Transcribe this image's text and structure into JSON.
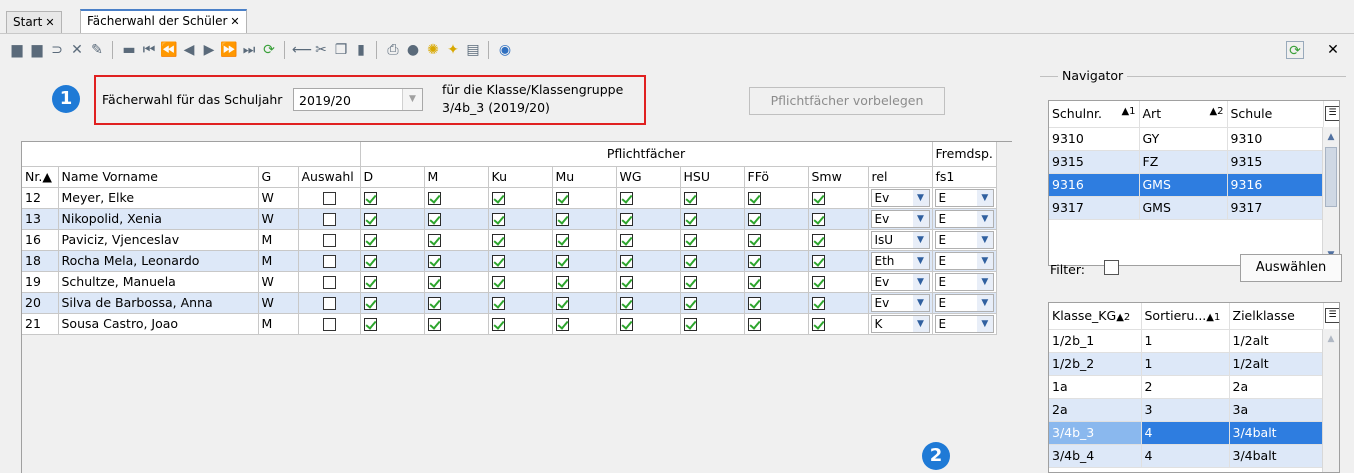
{
  "tabs": [
    {
      "label": "Start",
      "close": "✕"
    },
    {
      "label": "Fächerwahl der Schüler",
      "close": "✕"
    }
  ],
  "toolbar": {
    "icons": [
      "save-icon",
      "save-all-icon",
      "undo-icon",
      "delete-icon",
      "edit-icon",
      "new-icon",
      "first-icon",
      "prev-page-icon",
      "prev-icon",
      "next-icon",
      "next-page-icon",
      "last-icon",
      "refresh-icon",
      "back-icon",
      "cut-icon",
      "copy-icon",
      "paste-icon",
      "print-icon",
      "preview-icon",
      "hint-icon",
      "clean-icon",
      "list-icon",
      "help-icon"
    ],
    "right_icons": [
      "sync-icon",
      "close-icon"
    ],
    "close_label": "✕"
  },
  "header": {
    "badge1": "1",
    "schuljahr_label": "Fächerwahl für das Schuljahr",
    "schuljahr_value": "2019/20",
    "klasse_label": "für die Klasse/Klassengruppe",
    "klasse_value": "3/4b_3 (2019/20)",
    "pflicht_button": "Pflichtfächer vorbelegen"
  },
  "grid": {
    "group_pflicht": "Pflichtfächer",
    "group_fremd": "Fremdsp.",
    "columns": [
      "Nr.",
      "Name Vorname",
      "G",
      "Auswahl",
      "D",
      "M",
      "Ku",
      "Mu",
      "WG",
      "HSU",
      "FFö",
      "Smw",
      "rel",
      "fs1"
    ],
    "sort_indicator": "▲",
    "rows": [
      {
        "nr": "12",
        "name": "Meyer, Elke",
        "g": "W",
        "rel": "Ev",
        "fs1": "E"
      },
      {
        "nr": "13",
        "name": "Nikopolid, Xenia",
        "g": "W",
        "rel": "Ev",
        "fs1": "E"
      },
      {
        "nr": "16",
        "name": "Paviciz, Vjenceslav",
        "g": "M",
        "rel": "IsU",
        "fs1": "E"
      },
      {
        "nr": "18",
        "name": "Rocha Mela, Leonardo",
        "g": "M",
        "rel": "Eth",
        "fs1": "E"
      },
      {
        "nr": "19",
        "name": "Schultze, Manuela",
        "g": "W",
        "rel": "Ev",
        "fs1": "E"
      },
      {
        "nr": "20",
        "name": "Silva de Barbossa, Anna",
        "g": "W",
        "rel": "Ev",
        "fs1": "E"
      },
      {
        "nr": "21",
        "name": "Sousa Castro, Joao",
        "g": "M",
        "rel": "K",
        "fs1": "E"
      }
    ],
    "badge2": "2"
  },
  "navigator": {
    "title": "Navigator",
    "columns": [
      "Schulnr.",
      "▲1",
      "Art",
      "▲2",
      "Schule"
    ],
    "rows": [
      {
        "schulnr": "9310",
        "art": "GY",
        "schule": "9310"
      },
      {
        "schulnr": "9315",
        "art": "FZ",
        "schule": "9315"
      },
      {
        "schulnr": "9316",
        "art": "GMS",
        "schule": "9316"
      },
      {
        "schulnr": "9317",
        "art": "GMS",
        "schule": "9317"
      }
    ],
    "filter_label": "Filter:",
    "auswaehlen_button": "Auswählen"
  },
  "klassen": {
    "columns": [
      "Klasse_KG",
      "▲2",
      "Sortieru...",
      "▲1",
      "Zielklasse"
    ],
    "rows": [
      {
        "klasse": "1/2b_1",
        "sort": "1",
        "ziel": "1/2alt"
      },
      {
        "klasse": "1/2b_2",
        "sort": "1",
        "ziel": "1/2alt"
      },
      {
        "klasse": "1a",
        "sort": "2",
        "ziel": "2a"
      },
      {
        "klasse": "2a",
        "sort": "3",
        "ziel": "3a"
      },
      {
        "klasse": "3/4b_3",
        "sort": "4",
        "ziel": "3/4balt"
      },
      {
        "klasse": "3/4b_4",
        "sort": "4",
        "ziel": "3/4balt"
      }
    ]
  },
  "colors": {
    "accent": "#2e7de0",
    "row_alt": "#dde8f8",
    "red_highlight": "#e02020",
    "badge": "#1f7ad6",
    "check": "#2da52d"
  }
}
